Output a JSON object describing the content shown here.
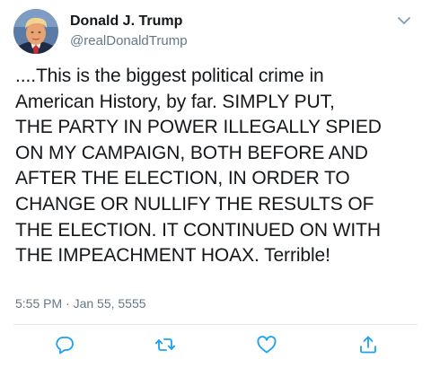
{
  "tweet": {
    "author": {
      "display_name": "Donald J. Trump",
      "handle": "@realDonaldTrump",
      "avatar_icon": "profile-photo"
    },
    "menu_icon": "chevron-down-icon",
    "text": "....This is the biggest political crime in\nAmerican History, by far. SIMPLY PUT,\nTHE PARTY IN POWER ILLEGALLY SPIED\nON MY CAMPAIGN, BOTH BEFORE AND\nAFTER THE ELECTION, IN ORDER TO\nCHANGE OR NULLIFY THE RESULTS OF\nTHE ELECTION. IT CONTINUED ON WITH\nTHE IMPEACHMENT HOAX. Terrible!",
    "timestamp": "5:55 PM · Jan 55, 5555",
    "actions": [
      {
        "icon": "reply-icon"
      },
      {
        "icon": "retweet-icon"
      },
      {
        "icon": "like-icon"
      },
      {
        "icon": "share-icon"
      }
    ]
  },
  "colors": {
    "text": "#14171a",
    "secondary": "#657786",
    "divider": "#e1e8ed",
    "action_icon": "#1da1f2"
  }
}
